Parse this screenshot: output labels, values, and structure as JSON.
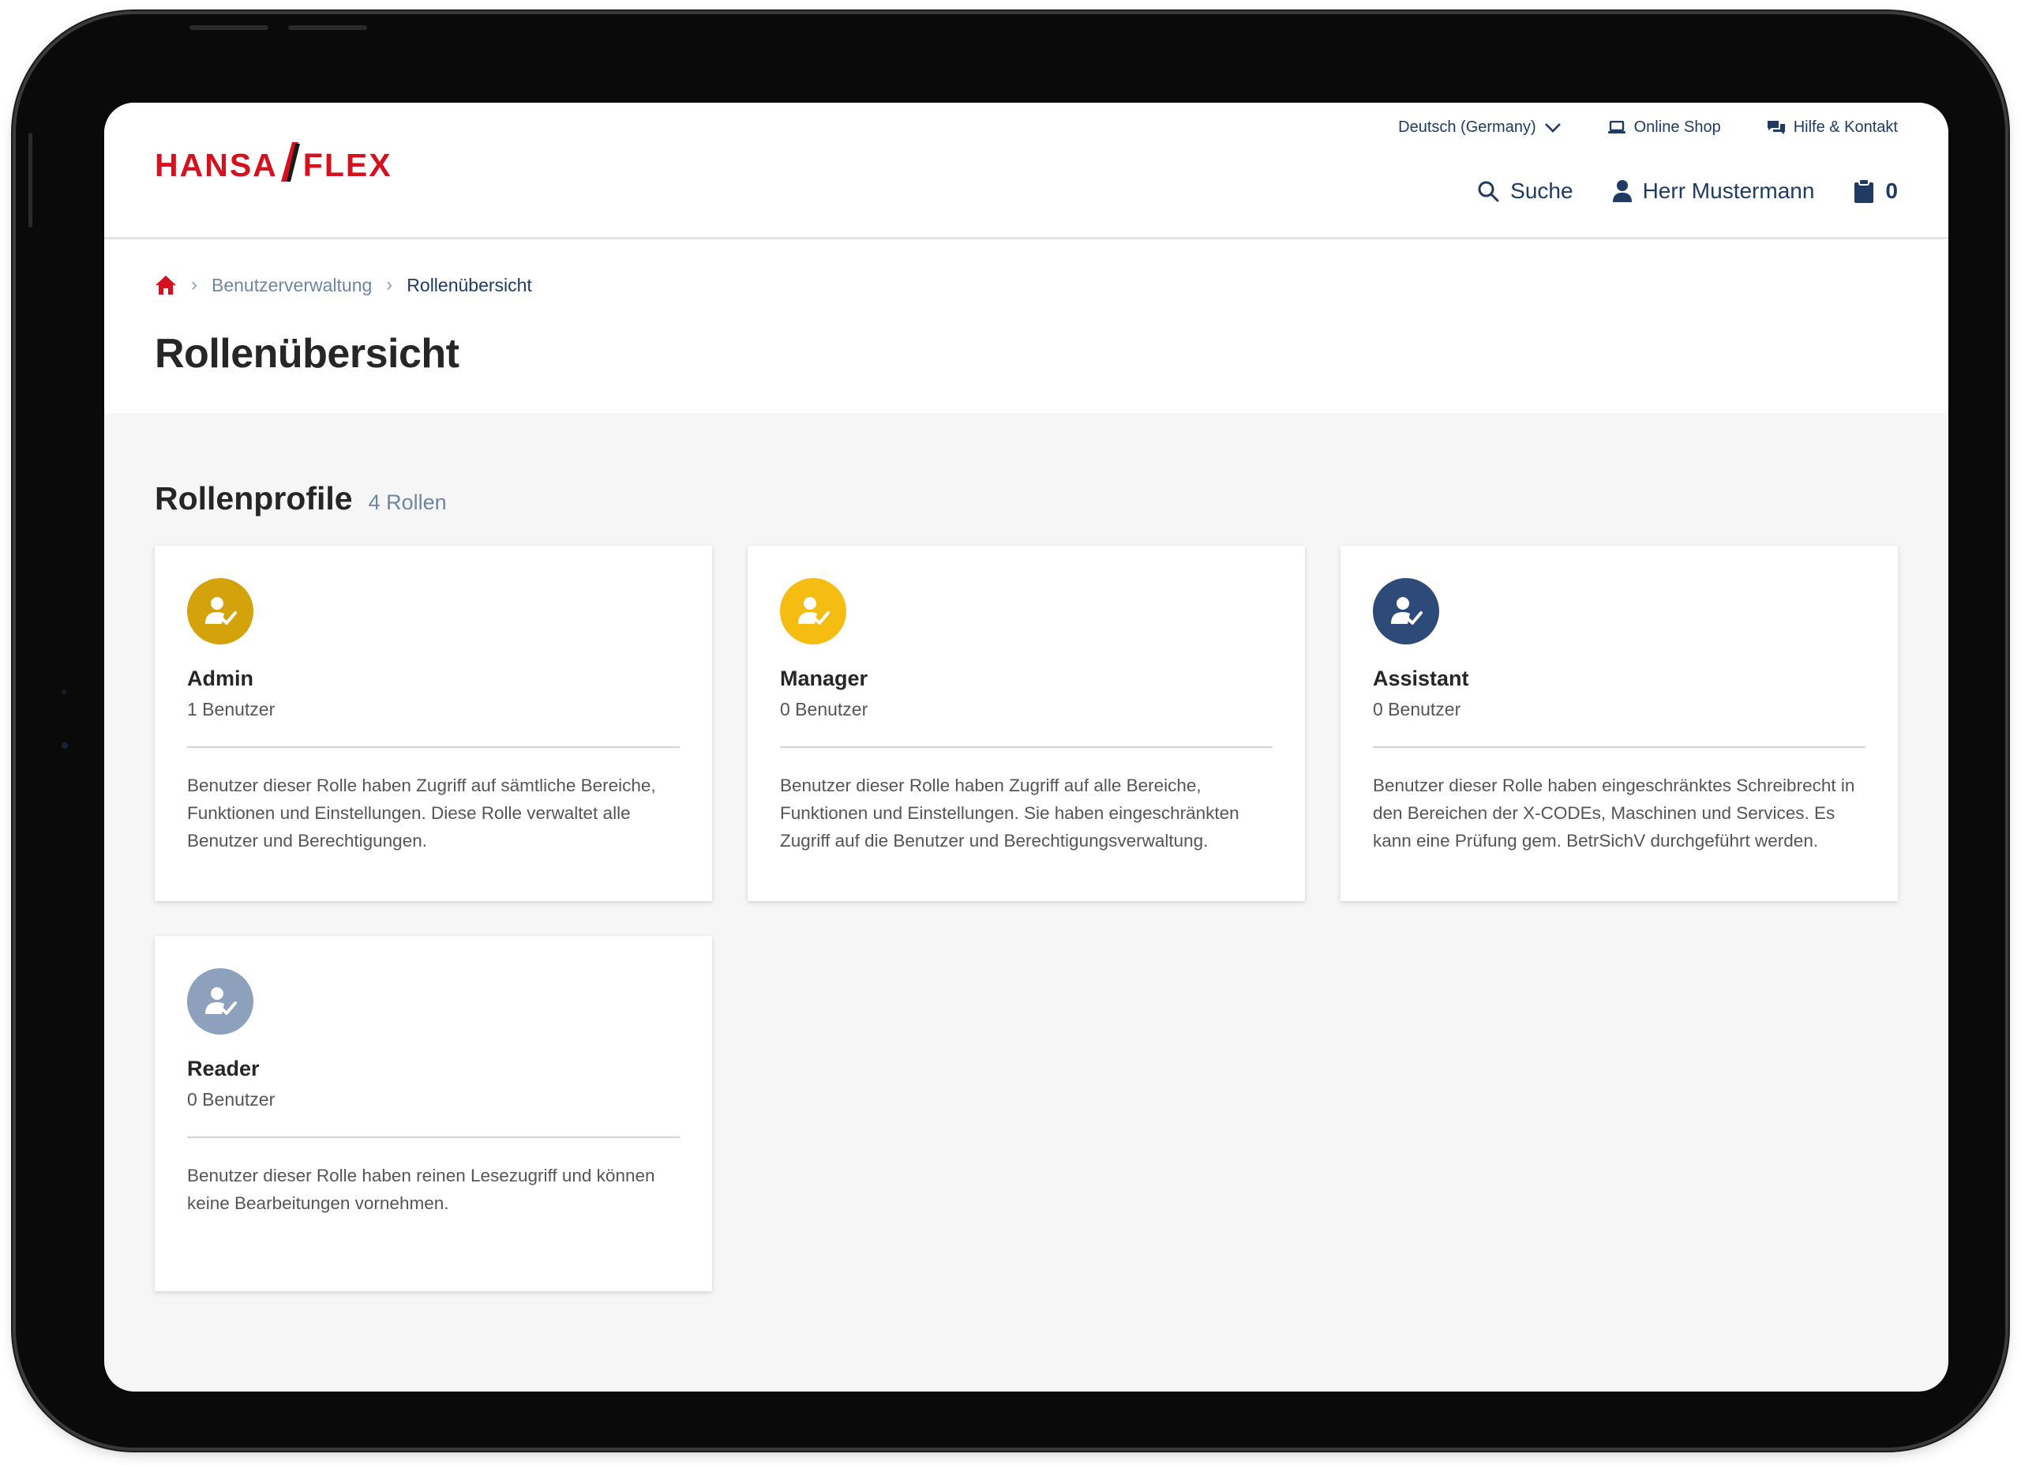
{
  "header": {
    "logo_left": "HANSA",
    "logo_right": "FLEX",
    "language": "Deutsch (Germany)",
    "online_shop": "Online Shop",
    "help": "Hilfe & Kontakt",
    "search": "Suche",
    "user": "Herr Mustermann",
    "cart_count": "0"
  },
  "breadcrumb": {
    "items": [
      "Benutzerverwaltung",
      "Rollenübersicht"
    ]
  },
  "page": {
    "title": "Rollenübersicht"
  },
  "section": {
    "title": "Rollenprofile",
    "count": "4 Rollen"
  },
  "roles": [
    {
      "name": "Admin",
      "users": "1 Benutzer",
      "description": "Benutzer dieser Rolle haben Zugriff auf sämtliche Bereiche, Funktionen und Einstellungen. Diese Rolle verwaltet alle Benutzer und Berechtigungen.",
      "color": "#d4a20a"
    },
    {
      "name": "Manager",
      "users": "0 Benutzer",
      "description": "Benutzer dieser Rolle haben Zugriff auf alle Bereiche, Funktionen und Einstellungen. Sie haben eingeschränkten Zugriff auf die Benutzer und Berechtigungsverwaltung.",
      "color": "#f5bc12"
    },
    {
      "name": "Assistant",
      "users": "0 Benutzer",
      "description": "Benutzer dieser Rolle haben eingeschränktes Schreibrecht in den Bereichen der X-CODEs, Maschinen und Services. Es kann eine Prüfung gem. BetrSichV durchgeführt werden.",
      "color": "#2d4a78"
    },
    {
      "name": "Reader",
      "users": "0 Benutzer",
      "description": "Benutzer dieser Rolle haben reinen Lesezugriff und können keine Bearbeitungen vornehmen.",
      "color": "#8da0bc"
    }
  ],
  "colors": {
    "brand_red": "#d6111f",
    "nav_blue": "#1f3b63",
    "muted_blue": "#6e85a6"
  }
}
